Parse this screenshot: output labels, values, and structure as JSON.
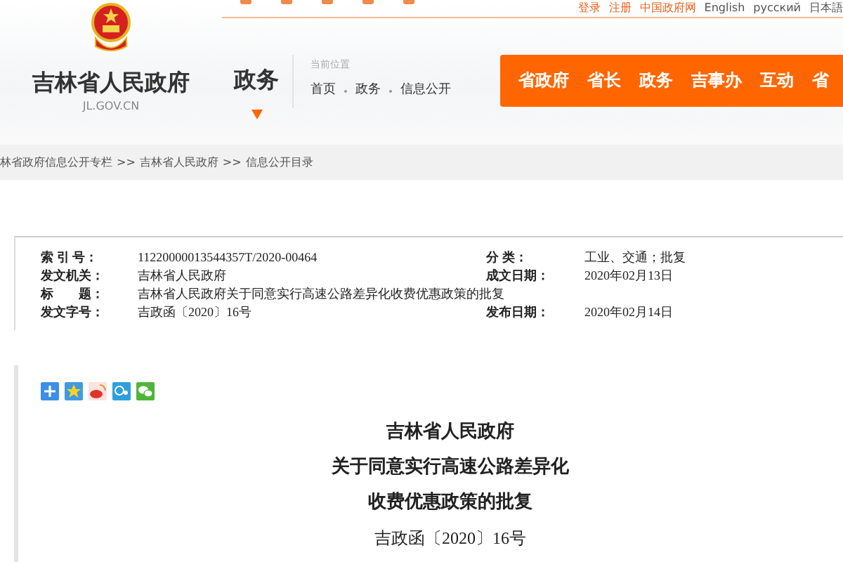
{
  "top_links": [
    "登录",
    "注册",
    "中国政府网",
    "English",
    "русский",
    "日本語"
  ],
  "site": {
    "name": "吉林省人民政府",
    "domain": "JL.GOV.CN"
  },
  "section": "政务",
  "location": {
    "label": "当前位置",
    "crumbs": [
      "首页",
      "政务",
      "信息公开"
    ]
  },
  "nav": [
    "省政府",
    "省长",
    "政务",
    "吉事办",
    "互动",
    "省"
  ],
  "breadcrumb": {
    "separator": ">>",
    "items": [
      "林省政府信息公开专栏",
      "吉林省人民政府",
      "信息公开目录"
    ]
  },
  "meta": [
    [
      {
        "label": "索 引 号：",
        "value": "11220000013544357T/2020-00464"
      },
      {
        "label": "分 类：",
        "value": "工业、交通；批复"
      }
    ],
    [
      {
        "label": "发文机关：",
        "value": "吉林省人民政府"
      },
      {
        "label": "成文日期：",
        "value": "2020年02月13日"
      }
    ],
    [
      {
        "label": "标　　题：",
        "value": "吉林省人民政府关于同意实行高速公路差异化收费优惠政策的批复"
      }
    ],
    [
      {
        "label": "发文字号：",
        "value": "吉政函〔2020〕16号"
      },
      {
        "label": "发布日期：",
        "value": "2020年02月14日"
      }
    ]
  ],
  "article": {
    "title_lines": [
      "吉林省人民政府",
      "关于同意实行高速公路差异化",
      "收费优惠政策的批复"
    ],
    "doc_number": "吉政函〔2020〕16号"
  }
}
